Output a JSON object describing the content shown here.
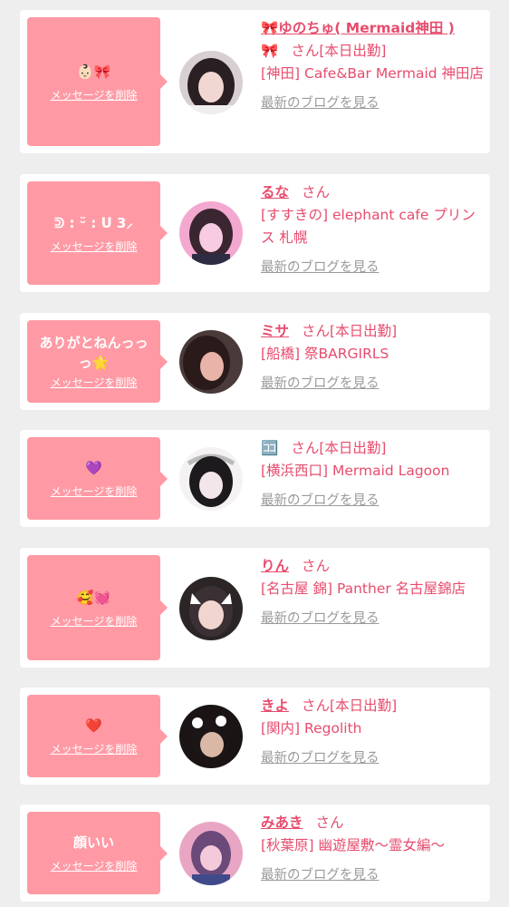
{
  "delete_label": "メッセージを削除",
  "blog_label": "最新のブログを見る",
  "honorific": "さん",
  "work_today": "[本日出勤]",
  "cards": [
    {
      "message": "👶🏻🎀",
      "name": "🎀ゆのちゅ( Mermaid神田 )",
      "name_line2": "🎀",
      "status": "[本日出勤]",
      "shop": "[神田] Cafe&Bar Mermaid 神田店",
      "avatar_colors": [
        "#2a1f22",
        "#f1d7d2"
      ]
    },
    {
      "message": "ᕲ : ᵕ̈ : ᑌ 3⸝",
      "name": "るな",
      "status": "",
      "shop": "[すすきの] elephant cafe プリンス 札幌",
      "avatar_colors": [
        "#3a2630",
        "#f7cbe1"
      ]
    },
    {
      "message": "ありがとねんっっ\nっ🌟",
      "name": "ミサ",
      "status": "[本日出勤]",
      "shop": "[船橋] 祭BARGIRLS",
      "avatar_colors": [
        "#2a1a1a",
        "#e8b3a8"
      ]
    },
    {
      "message": "💜",
      "name": "🈁",
      "status": "[本日出勤]",
      "shop": "[横浜西口] Mermaid Lagoon",
      "avatar_colors": [
        "#1d1a1e",
        "#f3e6ea"
      ]
    },
    {
      "message": "🥰💓",
      "name": "りん",
      "status": "",
      "shop": "[名古屋 錦] Panther 名古屋錦店",
      "avatar_colors": [
        "#3b3033",
        "#f0d6cf"
      ]
    },
    {
      "message": "❤️",
      "name": "きよ",
      "status": "[本日出勤]",
      "shop": "[関内] Regolith",
      "avatar_colors": [
        "#1c1516",
        "#d9b8a6"
      ]
    },
    {
      "message": "顔いい",
      "name": "みあき",
      "status": "",
      "shop": "[秋葉原] 幽遊屋敷〜霊女編〜",
      "avatar_colors": [
        "#6b4a7a",
        "#f4c9d9"
      ]
    }
  ]
}
